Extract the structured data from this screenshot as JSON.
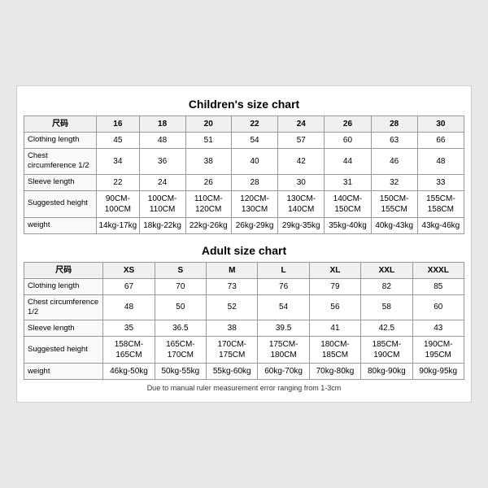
{
  "children_chart": {
    "title": "Children's size chart",
    "columns": [
      "尺码",
      "16",
      "18",
      "20",
      "22",
      "24",
      "26",
      "28",
      "30"
    ],
    "rows": [
      {
        "label": "Clothing length",
        "values": [
          "45",
          "48",
          "51",
          "54",
          "57",
          "60",
          "63",
          "66"
        ]
      },
      {
        "label": "Chest circumference 1/2",
        "values": [
          "34",
          "36",
          "38",
          "40",
          "42",
          "44",
          "46",
          "48"
        ]
      },
      {
        "label": "Sleeve length",
        "values": [
          "22",
          "24",
          "26",
          "28",
          "30",
          "31",
          "32",
          "33"
        ]
      },
      {
        "label": "Suggested height",
        "values": [
          "90CM-100CM",
          "100CM-110CM",
          "110CM-120CM",
          "120CM-130CM",
          "130CM-140CM",
          "140CM-150CM",
          "150CM-155CM",
          "155CM-158CM"
        ]
      },
      {
        "label": "weight",
        "values": [
          "14kg-17kg",
          "18kg-22kg",
          "22kg-26kg",
          "26kg-29kg",
          "29kg-35kg",
          "35kg-40kg",
          "40kg-43kg",
          "43kg-46kg"
        ]
      }
    ]
  },
  "adult_chart": {
    "title": "Adult size chart",
    "columns": [
      "尺码",
      "XS",
      "S",
      "M",
      "L",
      "XL",
      "XXL",
      "XXXL"
    ],
    "rows": [
      {
        "label": "Clothing length",
        "values": [
          "67",
          "70",
          "73",
          "76",
          "79",
          "82",
          "85"
        ]
      },
      {
        "label": "Chest circumference 1/2",
        "values": [
          "48",
          "50",
          "52",
          "54",
          "56",
          "58",
          "60"
        ]
      },
      {
        "label": "Sleeve length",
        "values": [
          "35",
          "36.5",
          "38",
          "39.5",
          "41",
          "42.5",
          "43"
        ]
      },
      {
        "label": "Suggested height",
        "values": [
          "158CM-165CM",
          "165CM-170CM",
          "170CM-175CM",
          "175CM-180CM",
          "180CM-185CM",
          "185CM-190CM",
          "190CM-195CM"
        ]
      },
      {
        "label": "weight",
        "values": [
          "46kg-50kg",
          "50kg-55kg",
          "55kg-60kg",
          "60kg-70kg",
          "70kg-80kg",
          "80kg-90kg",
          "90kg-95kg"
        ]
      }
    ]
  },
  "footnote": "Due to manual ruler measurement error ranging from 1-3cm"
}
